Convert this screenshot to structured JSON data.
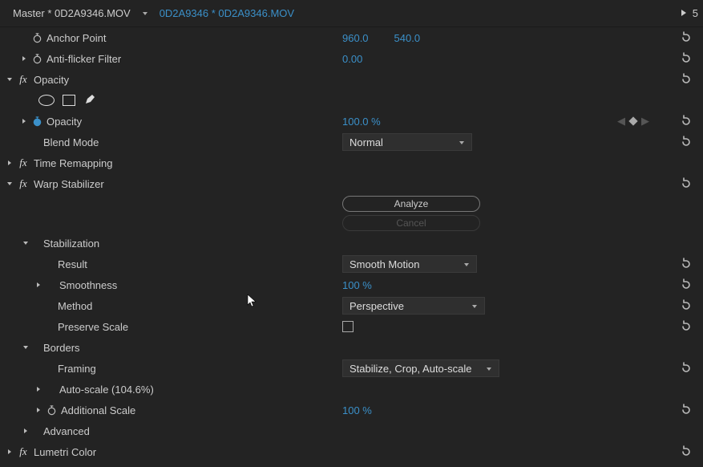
{
  "header": {
    "tab1": "Master * 0D2A9346.MOV",
    "tab2": "0D2A9346 * 0D2A9346.MOV",
    "right_num": "5"
  },
  "anchor": {
    "label": "Anchor Point",
    "val1": "960.0",
    "val2": "540.0"
  },
  "antiflicker": {
    "label": "Anti-flicker Filter",
    "val": "0.00"
  },
  "opacity": {
    "group": "Opacity",
    "label": "Opacity",
    "val": "100.0 %",
    "blend_label": "Blend Mode",
    "blend_val": "Normal"
  },
  "timeremap": {
    "label": "Time Remapping"
  },
  "warp": {
    "group": "Warp Stabilizer",
    "analyze": "Analyze",
    "cancel": "Cancel",
    "stab_group": "Stabilization",
    "result_label": "Result",
    "result_val": "Smooth Motion",
    "smooth_label": "Smoothness",
    "smooth_val": "100 %",
    "method_label": "Method",
    "method_val": "Perspective",
    "preserve_label": "Preserve Scale",
    "borders_group": "Borders",
    "framing_label": "Framing",
    "framing_val": "Stabilize, Crop, Auto-scale",
    "autoscale_label": "Auto-scale (104.6%)",
    "addscale_label": "Additional Scale",
    "addscale_val": "100 %",
    "advanced_label": "Advanced"
  },
  "lumetri": {
    "label": "Lumetri Color"
  }
}
